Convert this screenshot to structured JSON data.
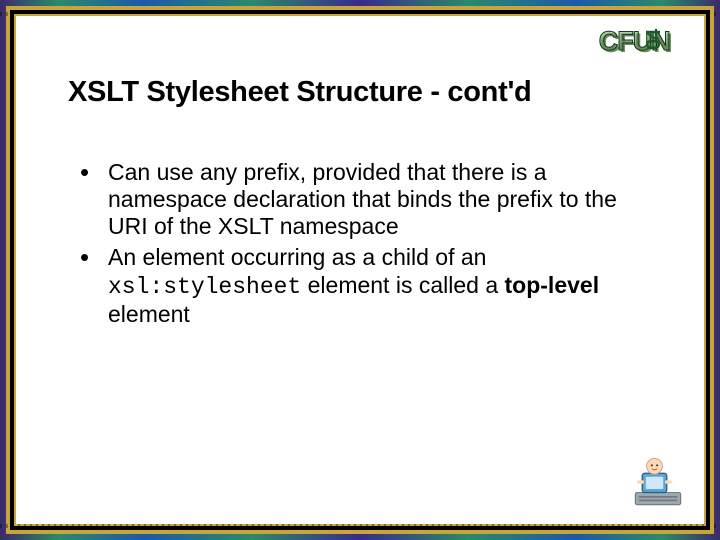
{
  "logo": {
    "brand": "CFUN",
    "year": "04"
  },
  "title": "XSLT Stylesheet Structure - cont'd",
  "bullets": [
    {
      "segments": [
        {
          "text": "Can use any prefix, provided that there is a namespace declaration that binds the prefix to the URI of the XSLT namespace"
        }
      ]
    },
    {
      "segments": [
        {
          "text": "An element occurring as a child of an "
        },
        {
          "text": "xsl:stylesheet",
          "code": true
        },
        {
          "text": " element is called a "
        },
        {
          "text": "top-level",
          "bold": true
        },
        {
          "text": " element"
        }
      ]
    }
  ]
}
